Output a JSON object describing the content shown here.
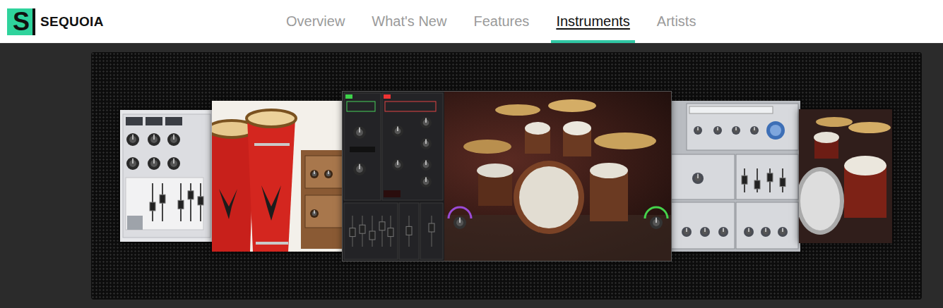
{
  "brand": {
    "mark": "S",
    "name": "SEQUOIA"
  },
  "nav": [
    {
      "label": "Overview",
      "selected": false
    },
    {
      "label": "What's New",
      "selected": false
    },
    {
      "label": "Features",
      "selected": false
    },
    {
      "label": "Instruments",
      "selected": true
    },
    {
      "label": "Artists",
      "selected": false
    }
  ],
  "carousel": {
    "slides": [
      {
        "kind": "panel-light",
        "selected": false
      },
      {
        "kind": "congas",
        "selected": false
      },
      {
        "kind": "drumkit-center",
        "selected": true
      },
      {
        "kind": "panel-silver",
        "selected": false
      },
      {
        "kind": "drumkit",
        "selected": false
      }
    ]
  }
}
